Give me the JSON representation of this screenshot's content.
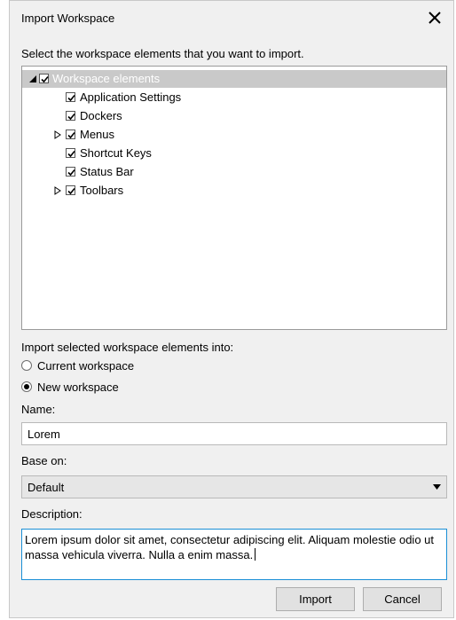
{
  "window": {
    "title": "Import Workspace"
  },
  "instruction": "Select the workspace elements that you want to import.",
  "tree": {
    "root": {
      "label": "Workspace elements",
      "checked": true,
      "expanded": true
    },
    "children": [
      {
        "label": "Application Settings",
        "checked": true,
        "expandable": false
      },
      {
        "label": "Dockers",
        "checked": true,
        "expandable": false
      },
      {
        "label": "Menus",
        "checked": true,
        "expandable": true
      },
      {
        "label": "Shortcut Keys",
        "checked": true,
        "expandable": false
      },
      {
        "label": "Status Bar",
        "checked": true,
        "expandable": false
      },
      {
        "label": "Toolbars",
        "checked": true,
        "expandable": true
      }
    ]
  },
  "import_into": {
    "label": "Import selected workspace elements into:",
    "options": [
      "Current workspace",
      "New workspace"
    ],
    "selected": "New workspace"
  },
  "name": {
    "label": "Name:",
    "value": "Lorem"
  },
  "base_on": {
    "label": "Base on:",
    "value": "Default"
  },
  "description": {
    "label": "Description:",
    "value": "Lorem ipsum dolor sit amet, consectetur adipiscing elit. Aliquam molestie odio ut massa vehicula viverra. Nulla a enim massa."
  },
  "buttons": {
    "import": "Import",
    "cancel": "Cancel"
  }
}
